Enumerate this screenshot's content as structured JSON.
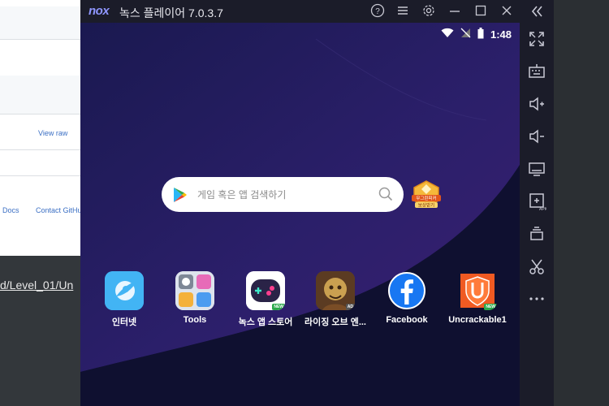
{
  "background_page": {
    "link_view_raw": "View raw",
    "link_docs": "Docs",
    "link_contact": "Contact GitHub",
    "path_text": "d/Level_01/Un"
  },
  "window": {
    "logo": "nox",
    "title": "녹스 플레이어 7.0.3.7",
    "controls": [
      "help-icon",
      "menu-icon",
      "settings-icon",
      "minimize-icon",
      "maximize-icon",
      "close-icon",
      "collapse-sidebar-icon"
    ]
  },
  "statusbar": {
    "time": "1:48"
  },
  "search": {
    "placeholder": "게임 혹은 앱 검색하기"
  },
  "promo": {
    "text_line1": "무그린피커",
    "text_line2": "보상받기"
  },
  "apps": [
    {
      "label": "인터넷",
      "icon": "browser-icon"
    },
    {
      "label": "Tools",
      "icon": "tools-folder-icon"
    },
    {
      "label": "녹스 앱 스토어",
      "icon": "app-store-icon",
      "badge": "NEW"
    },
    {
      "label": "라이징 오브 엔...",
      "icon": "game-icon",
      "badge": "AD"
    },
    {
      "label": "Facebook",
      "icon": "facebook-icon"
    },
    {
      "label": "Uncrackable1",
      "icon": "uncrackable-icon",
      "badge": "NEW"
    }
  ],
  "sidebar": [
    "fullscreen-icon",
    "keyboard-icon",
    "volume-up-icon",
    "volume-down-icon",
    "screen-icon",
    "apk-install-icon",
    "multi-instance-icon",
    "scissors-icon",
    "more-icon"
  ],
  "colors": {
    "accent": "#8f96ff",
    "screen_bg": "#16163a",
    "titlebar": "#1b1c29"
  }
}
